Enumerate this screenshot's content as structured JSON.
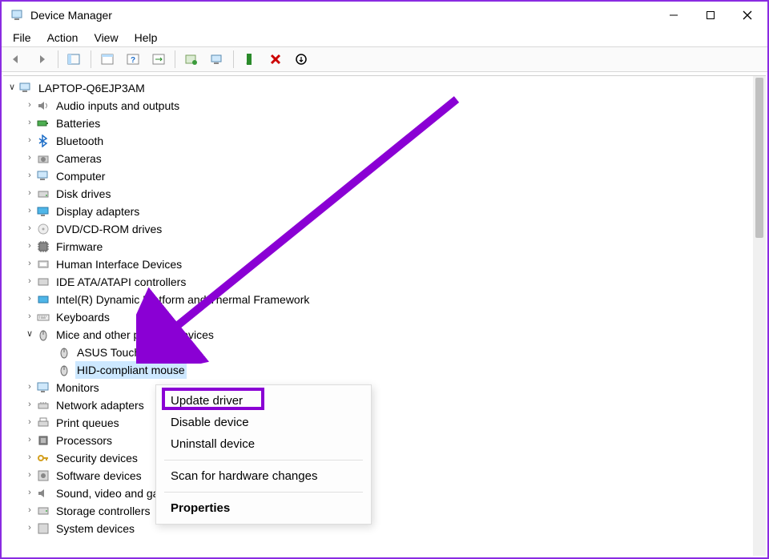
{
  "window": {
    "title": "Device Manager"
  },
  "menu": {
    "file": "File",
    "action": "Action",
    "view": "View",
    "help": "Help"
  },
  "root": {
    "label": "LAPTOP-Q6EJP3AM"
  },
  "categories": {
    "audio": "Audio inputs and outputs",
    "batteries": "Batteries",
    "bluetooth": "Bluetooth",
    "cameras": "Cameras",
    "computer": "Computer",
    "disk": "Disk drives",
    "display": "Display adapters",
    "dvd": "DVD/CD-ROM drives",
    "firmware": "Firmware",
    "hid": "Human Interface Devices",
    "ide": "IDE ATA/ATAPI controllers",
    "intel": "Intel(R) Dynamic Platform and Thermal Framework",
    "keyboards": "Keyboards",
    "mice": "Mice and other pointing devices",
    "monitors": "Monitors",
    "network": "Network adapters",
    "print": "Print queues",
    "processors": "Processors",
    "security": "Security devices",
    "software": "Software devices",
    "sound": "Sound, video and game controllers",
    "storage": "Storage controllers",
    "system": "System devices"
  },
  "mice_children": {
    "asus": "ASUS Touchpad",
    "hid": "HID-compliant mouse"
  },
  "context": {
    "update": "Update driver",
    "disable": "Disable device",
    "uninstall": "Uninstall device",
    "scan": "Scan for hardware changes",
    "properties": "Properties"
  }
}
